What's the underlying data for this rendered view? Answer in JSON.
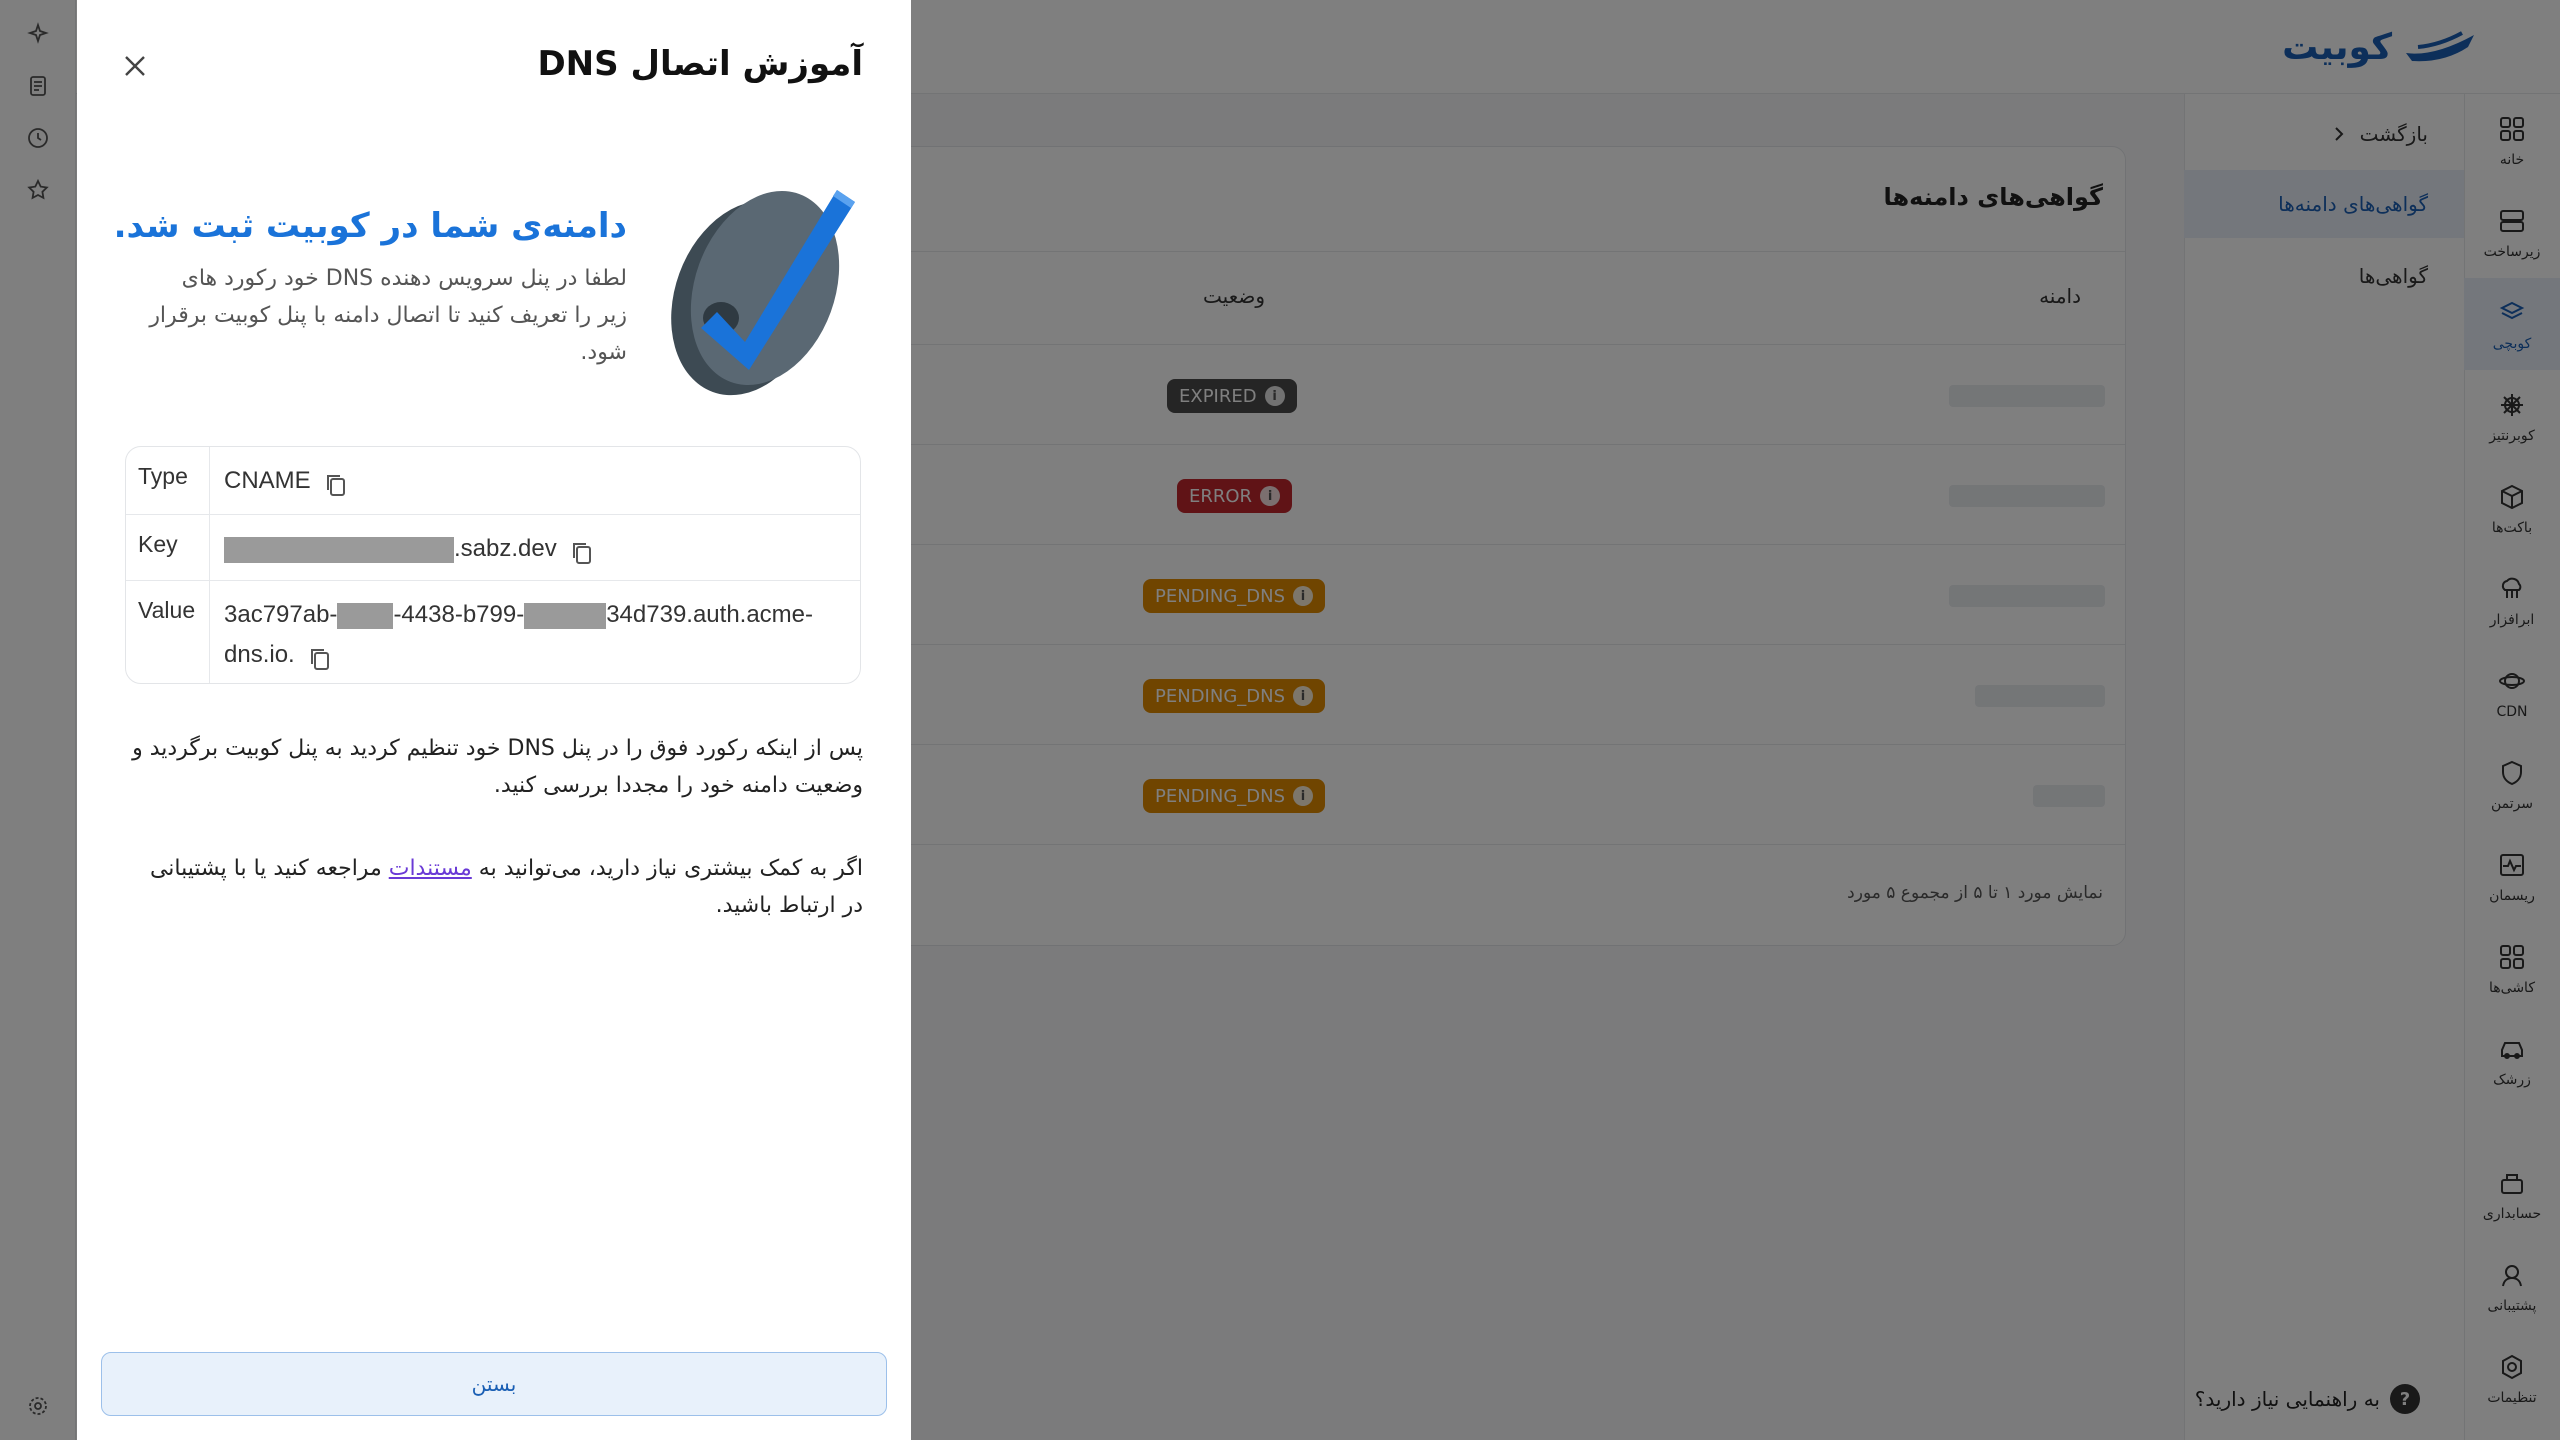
{
  "app": {
    "logo_text": "کوبیت",
    "back_label": "بازگشت",
    "subnav": [
      {
        "label": "گواهی‌های دامنه‌ها",
        "active": true
      },
      {
        "label": "گواهی‌ها",
        "active": false
      }
    ],
    "rail": [
      {
        "label": "خانه",
        "icon": "grid-icon"
      },
      {
        "label": "زیرساخت",
        "icon": "server-icon"
      },
      {
        "label": "کوبچی",
        "icon": "layers-icon",
        "active": true
      },
      {
        "label": "کوبرنتیز",
        "icon": "helm-icon"
      },
      {
        "label": "باکت‌ها",
        "icon": "cube-icon"
      },
      {
        "label": "ابرافزار",
        "icon": "cloud-app-icon"
      },
      {
        "label": "CDN",
        "icon": "globe-ring-icon"
      },
      {
        "label": "سرتمن",
        "icon": "shield-icon"
      },
      {
        "label": "ریسمان",
        "icon": "monitor-wave-icon"
      },
      {
        "label": "کاشی‌ها",
        "icon": "tiles-icon"
      },
      {
        "label": "زرشک",
        "icon": "car-icon"
      },
      {
        "label": "حسابداری",
        "icon": "accounting-icon"
      },
      {
        "label": "پشتیبانی",
        "icon": "support-icon"
      },
      {
        "label": "تنظیمات",
        "icon": "settings-icon"
      }
    ],
    "card_title": "گواهی‌های دامنه‌ها",
    "col_domain": "دامنه",
    "col_status": "وضعیت",
    "rows": [
      {
        "status": "EXPIRED",
        "color": "#4a4a4a"
      },
      {
        "status": "ERROR",
        "color": "#c0262d"
      },
      {
        "status": "PENDING_DNS",
        "color": "#e08a00"
      },
      {
        "status": "PENDING_DNS",
        "color": "#e08a00"
      },
      {
        "status": "PENDING_DNS",
        "color": "#e08a00"
      }
    ],
    "footer": "نمایش مورد ۱ تا ۵ از مجموع ۵ مورد",
    "help": "به راهنمایی نیاز دارید؟"
  },
  "drawer": {
    "title": "آموزش اتصال DNS",
    "heading": "دامنه‌ی شما در کوبیت ثبت شد.",
    "description": "لطفا در پنل سرویس دهنده DNS خود رکورد های زیر را تعریف کنید تا اتصال دامنه با پنل کوبیت برقرار شود.",
    "record": {
      "type_label": "Type",
      "type_value": "CNAME",
      "key_label": "Key",
      "key_suffix": ".sabz.dev",
      "value_label": "Value",
      "value_part1": "3ac797ab-",
      "value_part2": "-4438-b799-",
      "value_part3": "34d739.auth.acme-",
      "value_part4": "dns.io."
    },
    "para1": "پس از اینکه رکورد فوق را در پنل DNS خود تنظیم کردید به پنل کوبیت برگردید و وضعیت دامنه خود را مجددا بررسی کنید.",
    "para2_before": "اگر به کمک بیشتری نیاز دارید، می‌توانید به ",
    "para2_link": "مستندات",
    "para2_after": " مراجعه کنید یا با پشتیبانی در ارتباط باشید.",
    "close_button": "بستن"
  },
  "colors": {
    "accent": "#1a73d9",
    "link": "#6a3ad6"
  }
}
